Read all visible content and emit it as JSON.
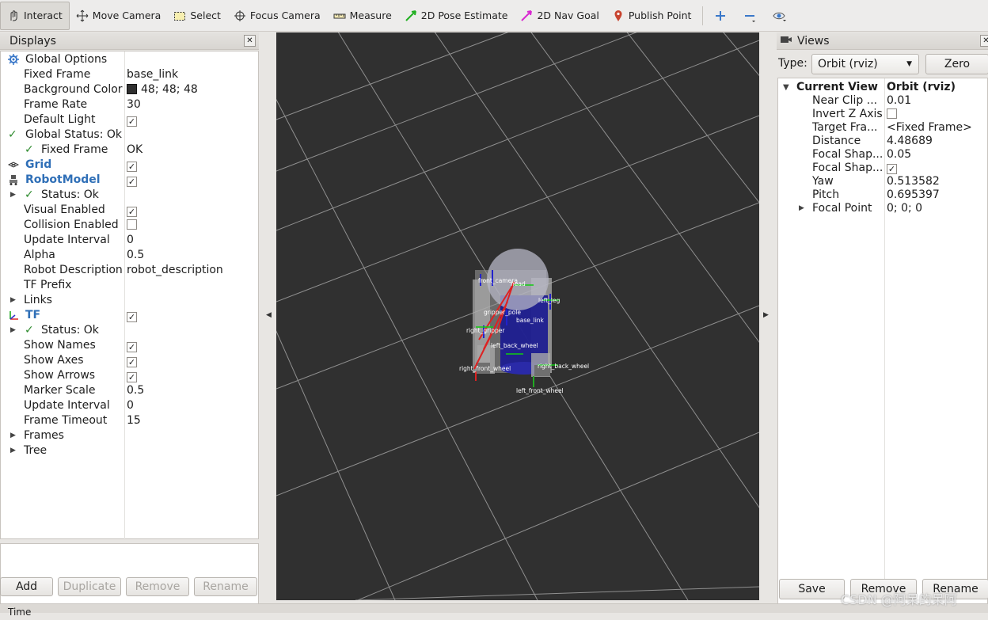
{
  "toolbar": {
    "interact": "Interact",
    "move_camera": "Move Camera",
    "select": "Select",
    "focus_camera": "Focus Camera",
    "measure": "Measure",
    "pose_estimate": "2D Pose Estimate",
    "nav_goal": "2D Nav Goal",
    "publish_point": "Publish Point"
  },
  "displays": {
    "title": "Displays",
    "rows": [
      {
        "key": "Global Options",
        "value": ""
      },
      {
        "key": "Fixed Frame",
        "value": "base_link"
      },
      {
        "key": "Background Color",
        "value": "48; 48; 48"
      },
      {
        "key": "Frame Rate",
        "value": "30"
      },
      {
        "key": "Default Light",
        "value": ""
      },
      {
        "key": "Global Status: Ok",
        "value": ""
      },
      {
        "key": "Fixed Frame",
        "value": "OK"
      },
      {
        "key": "Grid",
        "value": ""
      },
      {
        "key": "RobotModel",
        "value": ""
      },
      {
        "key": "Status: Ok",
        "value": ""
      },
      {
        "key": "Visual Enabled",
        "value": ""
      },
      {
        "key": "Collision Enabled",
        "value": ""
      },
      {
        "key": "Update Interval",
        "value": "0"
      },
      {
        "key": "Alpha",
        "value": "0.5"
      },
      {
        "key": "Robot Description",
        "value": "robot_description"
      },
      {
        "key": "TF Prefix",
        "value": ""
      },
      {
        "key": "Links",
        "value": ""
      },
      {
        "key": "TF",
        "value": ""
      },
      {
        "key": "Status: Ok",
        "value": ""
      },
      {
        "key": "Show Names",
        "value": ""
      },
      {
        "key": "Show Axes",
        "value": ""
      },
      {
        "key": "Show Arrows",
        "value": ""
      },
      {
        "key": "Marker Scale",
        "value": "0.5"
      },
      {
        "key": "Update Interval",
        "value": "0"
      },
      {
        "key": "Frame Timeout",
        "value": "15"
      },
      {
        "key": "Frames",
        "value": ""
      },
      {
        "key": "Tree",
        "value": ""
      }
    ],
    "buttons": {
      "add": "Add",
      "duplicate": "Duplicate",
      "remove": "Remove",
      "rename": "Rename"
    }
  },
  "viewport": {
    "labels": {
      "head": "head",
      "front_camera": "front_camera",
      "left_leg": "left_leg",
      "gripper_pole": "gripper_pole",
      "base_link": "base_link",
      "left_gripper": "right_gripper",
      "left_back_wheel": "left_back_wheel",
      "right_back_wheel": "right_back_wheel",
      "right_front_wheel": "right_front_wheel",
      "left_front_wheel": "left_front_wheel"
    },
    "background_color": "#303030"
  },
  "views": {
    "title": "Views",
    "type_label": "Type:",
    "type_value": "Orbit (rviz)",
    "zero": "Zero",
    "rows": [
      {
        "key": "Current View",
        "value": "Orbit (rviz)"
      },
      {
        "key": "Near Clip ...",
        "value": "0.01"
      },
      {
        "key": "Invert Z Axis",
        "value": ""
      },
      {
        "key": "Target Fra...",
        "value": "<Fixed Frame>"
      },
      {
        "key": "Distance",
        "value": "4.48689"
      },
      {
        "key": "Focal Shap...",
        "value": "0.05"
      },
      {
        "key": "Focal Shap...",
        "value": ""
      },
      {
        "key": "Yaw",
        "value": "0.513582"
      },
      {
        "key": "Pitch",
        "value": "0.695397"
      },
      {
        "key": "Focal Point",
        "value": "0; 0; 0"
      }
    ],
    "buttons": {
      "save": "Save",
      "remove": "Remove",
      "rename": "Rename"
    }
  },
  "bottom": {
    "label": "Time"
  },
  "watermark": "CSDN @阿呆的呆阿",
  "colors": {
    "ok": "#2e8b2e",
    "display_name": "#2f6fb7",
    "viewport_bg": "#303030"
  }
}
